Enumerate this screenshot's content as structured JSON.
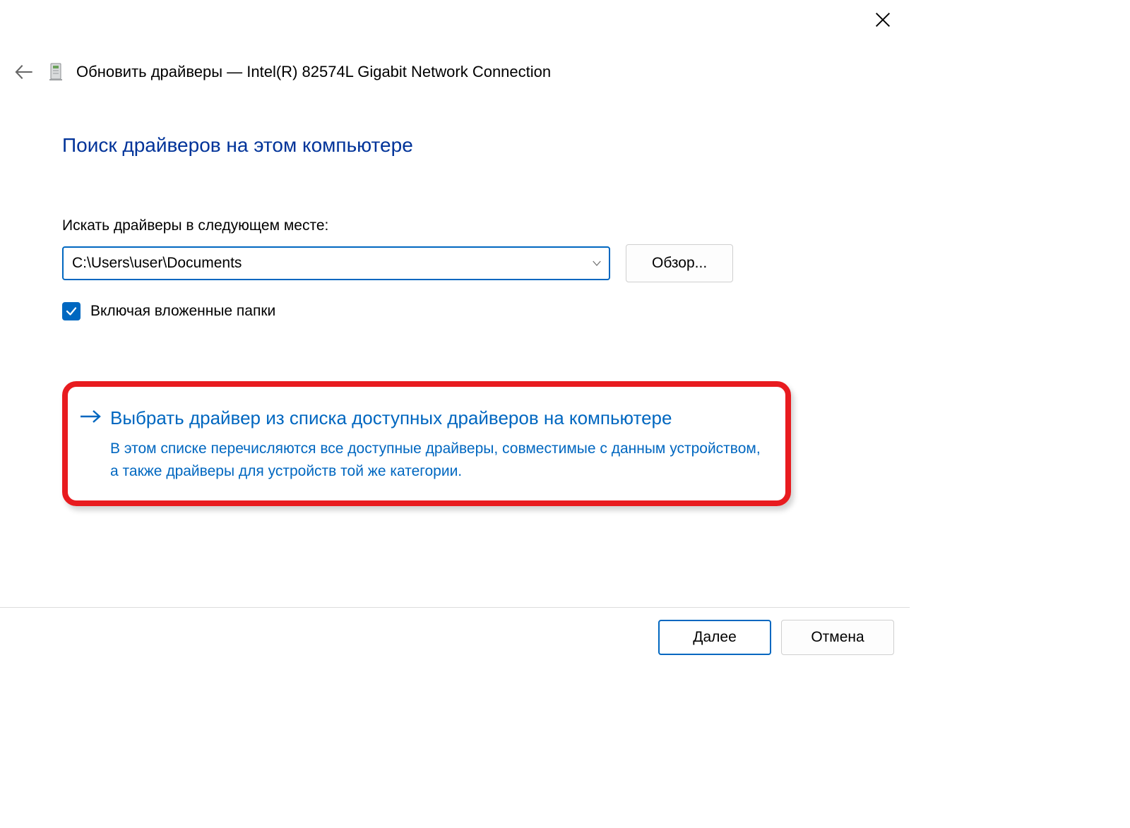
{
  "header": {
    "title": "Обновить драйверы — Intel(R) 82574L Gigabit Network Connection"
  },
  "main": {
    "heading": "Поиск драйверов на этом компьютере",
    "search_label": "Искать драйверы в следующем месте:",
    "path_value": "C:\\Users\\user\\Documents",
    "browse_label": "Обзор...",
    "include_subfolders_label": "Включая вложенные папки",
    "include_subfolders_checked": true
  },
  "option": {
    "title": "Выбрать драйвер из списка доступных драйверов на компьютере",
    "description": "В этом списке перечисляются все доступные драйверы, совместимые с данным устройством, а также драйверы для устройств той же категории."
  },
  "footer": {
    "next_label": "Далее",
    "cancel_label": "Отмена"
  }
}
